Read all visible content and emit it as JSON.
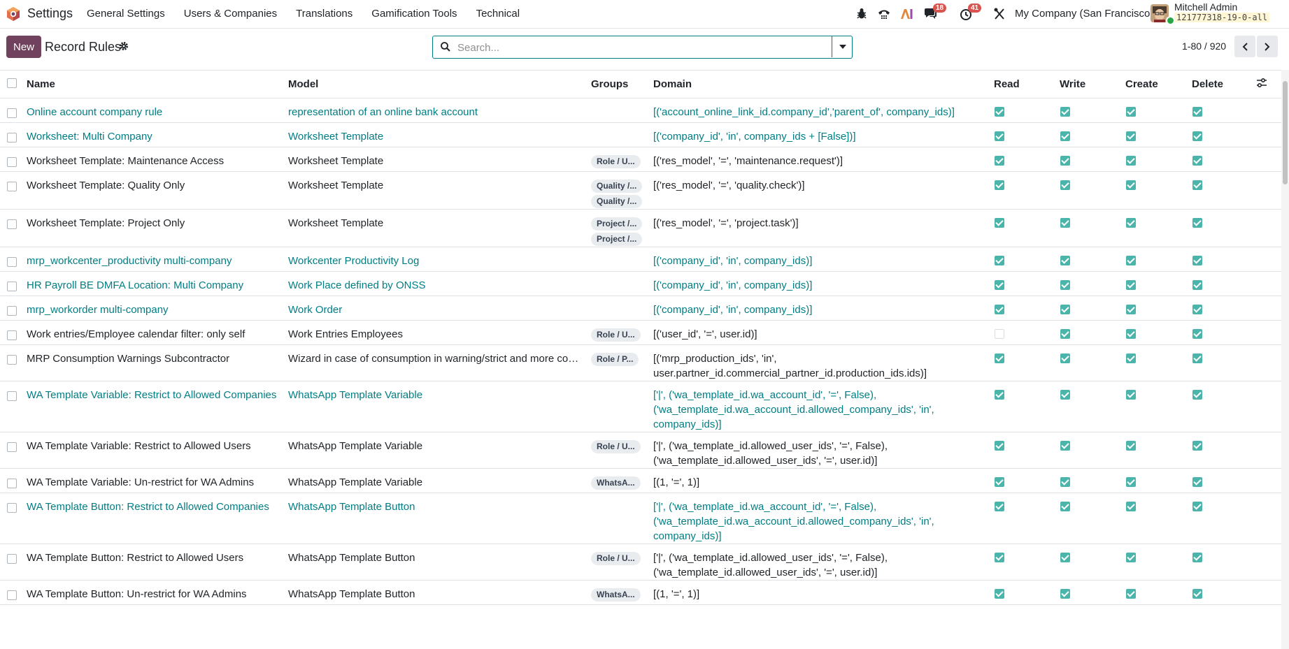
{
  "nav": {
    "app_name": "Settings",
    "menu": [
      "General Settings",
      "Users & Companies",
      "Translations",
      "Gamification Tools",
      "Technical"
    ],
    "messages_badge": "18",
    "activities_badge": "41",
    "company": "My Company (San Francisco)",
    "user_name": "Mitchell Admin",
    "db_name": "121777318-19-0-all"
  },
  "control": {
    "new_label": "New",
    "title": "Record Rules",
    "search_placeholder": "Search...",
    "pager": "1-80 / 920"
  },
  "colors": {
    "accent": "#017e84",
    "brand": "#71425d",
    "checkbox": "#4bb5ac"
  },
  "table": {
    "headers": {
      "name": "Name",
      "model": "Model",
      "groups": "Groups",
      "domain": "Domain",
      "read": "Read",
      "write": "Write",
      "create": "Create",
      "delete": "Delete"
    },
    "rows": [
      {
        "name": "Online account company rule",
        "model": "representation of an online bank account",
        "groups": [],
        "domain": "[('account_online_link_id.company_id','parent_of', company_ids)]",
        "read": true,
        "write": true,
        "create": true,
        "delete": true,
        "global": true
      },
      {
        "name": "Worksheet: Multi Company",
        "model": "Worksheet Template",
        "groups": [],
        "domain": "[('company_id', 'in', company_ids + [False])]",
        "read": true,
        "write": true,
        "create": true,
        "delete": true,
        "global": true
      },
      {
        "name": "Worksheet Template: Maintenance Access",
        "model": "Worksheet Template",
        "groups": [
          "Role / U..."
        ],
        "domain": "[('res_model', '=', 'maintenance.request')]",
        "read": true,
        "write": true,
        "create": true,
        "delete": true,
        "global": false
      },
      {
        "name": "Worksheet Template: Quality Only",
        "model": "Worksheet Template",
        "groups": [
          "Quality /...",
          "Quality /..."
        ],
        "domain": "[('res_model', '=', 'quality.check')]",
        "read": true,
        "write": true,
        "create": true,
        "delete": true,
        "global": false
      },
      {
        "name": "Worksheet Template: Project Only",
        "model": "Worksheet Template",
        "groups": [
          "Project /...",
          "Project /..."
        ],
        "domain": "[('res_model', '=', 'project.task')]",
        "read": true,
        "write": true,
        "create": true,
        "delete": true,
        "global": false
      },
      {
        "name": "mrp_workcenter_productivity multi-company",
        "model": "Workcenter Productivity Log",
        "groups": [],
        "domain": "[('company_id', 'in', company_ids)]",
        "read": true,
        "write": true,
        "create": true,
        "delete": true,
        "global": true
      },
      {
        "name": "HR Payroll BE DMFA Location: Multi Company",
        "model": "Work Place defined by ONSS",
        "groups": [],
        "domain": "[('company_id', 'in', company_ids)]",
        "read": true,
        "write": true,
        "create": true,
        "delete": true,
        "global": true
      },
      {
        "name": "mrp_workorder multi-company",
        "model": "Work Order",
        "groups": [],
        "domain": "[('company_id', 'in', company_ids)]",
        "read": true,
        "write": true,
        "create": true,
        "delete": true,
        "global": true
      },
      {
        "name": "Work entries/Employee calendar filter: only self",
        "model": "Work Entries Employees",
        "groups": [
          "Role / U..."
        ],
        "domain": "[('user_id', '=', user.id)]",
        "read": false,
        "write": true,
        "create": true,
        "delete": true,
        "global": false
      },
      {
        "name": "MRP Consumption Warnings Subcontractor",
        "model": "Wizard in case of consumption in warning/strict and more comp...",
        "groups": [
          "Role / P..."
        ],
        "domain": "[('mrp_production_ids', 'in', user.partner_id.commercial_partner_id.production_ids.ids)]",
        "read": true,
        "write": true,
        "create": true,
        "delete": true,
        "global": false
      },
      {
        "name": "WA Template Variable: Restrict to Allowed Companies",
        "model": "WhatsApp Template Variable",
        "groups": [],
        "domain": "['|', ('wa_template_id.wa_account_id', '=', False), ('wa_template_id.wa_account_id.allowed_company_ids', 'in', company_ids)]",
        "read": true,
        "write": true,
        "create": true,
        "delete": true,
        "global": true
      },
      {
        "name": "WA Template Variable: Restrict to Allowed Users",
        "model": "WhatsApp Template Variable",
        "groups": [
          "Role / U..."
        ],
        "domain": "['|', ('wa_template_id.allowed_user_ids', '=', False), ('wa_template_id.allowed_user_ids', '=', user.id)]",
        "read": true,
        "write": true,
        "create": true,
        "delete": true,
        "global": false
      },
      {
        "name": "WA Template Variable: Un-restrict for WA Admins",
        "model": "WhatsApp Template Variable",
        "groups": [
          "WhatsA..."
        ],
        "domain": "[(1, '=', 1)]",
        "read": true,
        "write": true,
        "create": true,
        "delete": true,
        "global": false
      },
      {
        "name": "WA Template Button: Restrict to Allowed Companies",
        "model": "WhatsApp Template Button",
        "groups": [],
        "domain": "['|', ('wa_template_id.wa_account_id', '=', False), ('wa_template_id.wa_account_id.allowed_company_ids', 'in', company_ids)]",
        "read": true,
        "write": true,
        "create": true,
        "delete": true,
        "global": true
      },
      {
        "name": "WA Template Button: Restrict to Allowed Users",
        "model": "WhatsApp Template Button",
        "groups": [
          "Role / U..."
        ],
        "domain": "['|', ('wa_template_id.allowed_user_ids', '=', False), ('wa_template_id.allowed_user_ids', '=', user.id)]",
        "read": true,
        "write": true,
        "create": true,
        "delete": true,
        "global": false
      },
      {
        "name": "WA Template Button: Un-restrict for WA Admins",
        "model": "WhatsApp Template Button",
        "groups": [
          "WhatsA..."
        ],
        "domain": "[(1, '=', 1)]",
        "read": true,
        "write": true,
        "create": true,
        "delete": true,
        "global": false
      }
    ]
  }
}
